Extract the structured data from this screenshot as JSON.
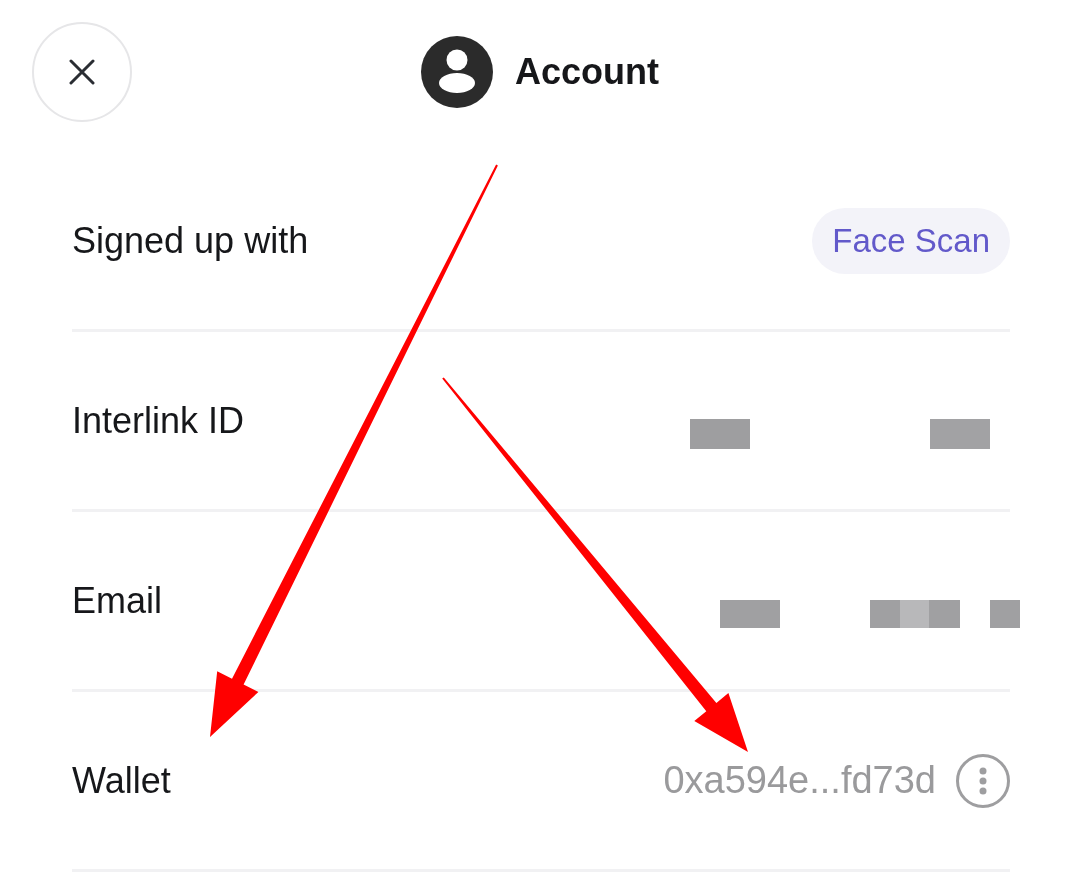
{
  "header": {
    "title": "Account"
  },
  "rows": [
    {
      "label": "Signed up with",
      "kind": "badge",
      "value": "Face Scan"
    },
    {
      "label": "Interlink ID",
      "kind": "redacted"
    },
    {
      "label": "Email",
      "kind": "redacted"
    },
    {
      "label": "Wallet",
      "kind": "address",
      "value": "0xa594e...fd73d"
    }
  ]
}
